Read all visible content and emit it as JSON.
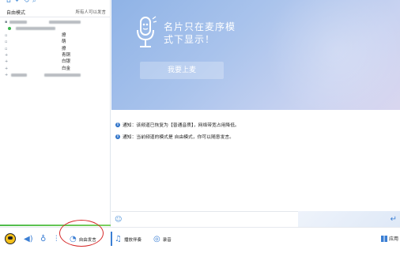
{
  "left_panel": {
    "mode_label": "自由模式",
    "mode_hint": "所有人可以发言",
    "channels": [
      {
        "label": "",
        "state": "blurred"
      },
      {
        "label": "",
        "state": "active-blurred"
      },
      {
        "label": "撩"
      },
      {
        "label": "萌"
      },
      {
        "label": "撩"
      },
      {
        "label": "青铜"
      },
      {
        "label": "白银"
      },
      {
        "label": "白金"
      },
      {
        "label": "",
        "state": "blurred"
      }
    ]
  },
  "stage": {
    "promo_text_line1": "名片只在麦序模",
    "promo_text_line2": "式下显示！",
    "up_button": "我要上麦"
  },
  "messages": [
    {
      "text": "通知：该频道已恢复为【普通音质】，网络带宽占用降低。"
    },
    {
      "text": "通知：当前频道的模式是 自由模式，你可以随意发言。"
    }
  ],
  "toolbar": {
    "free_speak": "自由发言",
    "play_accompaniment": "播放伴奏",
    "record": "录音",
    "apps": "应用"
  },
  "colors": {
    "accent": "#3b7fd4",
    "annotation": "#d62b2b",
    "status_green": "#39b54a"
  }
}
